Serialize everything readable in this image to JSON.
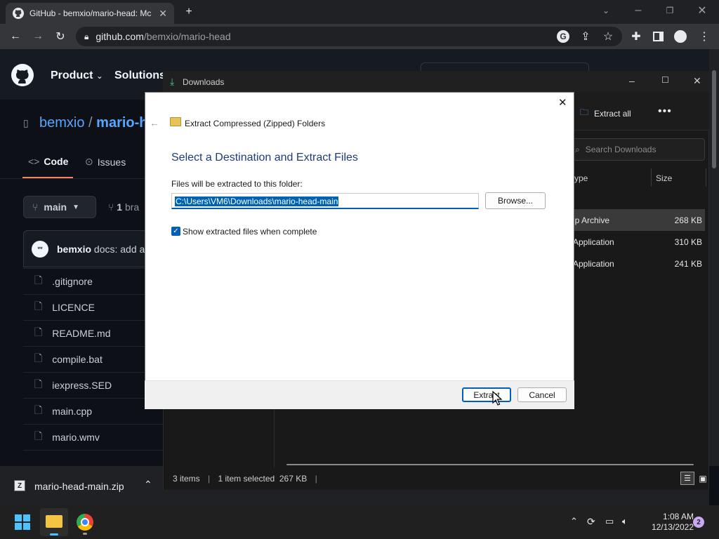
{
  "browser": {
    "tab_title": "GitHub - bemxio/mario-head: Mc",
    "url_host": "github.com",
    "url_path": "/bemxio/mario-head"
  },
  "github": {
    "nav": [
      "Product",
      "Solutions"
    ],
    "repo_owner": "bemxio",
    "repo_sep": "/",
    "repo_name": "mario-h",
    "tabs": [
      "Code",
      "Issues"
    ],
    "branch": "main",
    "branch_count": "1",
    "branch_word": "bra",
    "commit_user": "bemxio",
    "commit_msg": "docs: add a",
    "files": [
      ".gitignore",
      "LICENCE",
      "README.md",
      "compile.bat",
      "iexpress.SED",
      "main.cpp",
      "mario.wmv"
    ]
  },
  "explorer": {
    "title": "Downloads",
    "extract_all": "Extract all",
    "search_placeholder": "Search Downloads",
    "col_type": "ype",
    "col_size": "Size",
    "rows": [
      {
        "type": "ip Archive",
        "size": "268 KB"
      },
      {
        "type": "Application",
        "size": "310 KB"
      },
      {
        "type": "Application",
        "size": "241 KB"
      }
    ],
    "status_items": "3 items",
    "status_selected": "1 item selected  267 KB"
  },
  "dialog": {
    "title": "Extract Compressed (Zipped) Folders",
    "heading": "Select a Destination and Extract Files",
    "folder_label": "Files will be extracted to this folder:",
    "path": "C:\\Users\\VM6\\Downloads\\mario-head-main",
    "browse": "Browse...",
    "checkbox_label": "Show extracted files when complete",
    "checkbox_checked": true,
    "extract": "Extract",
    "cancel": "Cancel"
  },
  "downloads_bar": {
    "file": "mario-head-main.zip"
  },
  "taskbar": {
    "time": "1:08 AM",
    "date": "12/13/2022",
    "notification_count": "2"
  }
}
